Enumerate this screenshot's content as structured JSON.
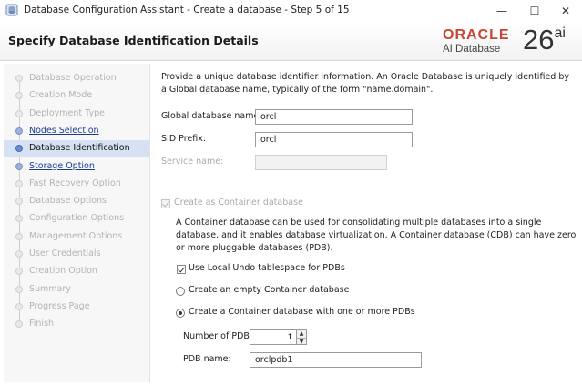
{
  "window": {
    "title": "Database Configuration Assistant - Create a database - Step 5 of 15",
    "controls": {
      "minimize": "—",
      "maximize": "☐",
      "close": "✕"
    }
  },
  "header": {
    "page_title": "Specify Database Identification Details",
    "logo": {
      "brand": "ORACLE",
      "product": "AI Database",
      "version": "26",
      "version_suffix": "ai",
      "brand_color": "#c74634"
    }
  },
  "nav": {
    "items": [
      {
        "label": "Database Operation",
        "state": "disabled"
      },
      {
        "label": "Creation Mode",
        "state": "disabled"
      },
      {
        "label": "Deployment Type",
        "state": "disabled"
      },
      {
        "label": "Nodes Selection",
        "state": "link"
      },
      {
        "label": "Database Identification",
        "state": "current"
      },
      {
        "label": "Storage Option",
        "state": "link"
      },
      {
        "label": "Fast Recovery Option",
        "state": "disabled"
      },
      {
        "label": "Database Options",
        "state": "disabled"
      },
      {
        "label": "Configuration Options",
        "state": "disabled"
      },
      {
        "label": "Management Options",
        "state": "disabled"
      },
      {
        "label": "User Credentials",
        "state": "disabled"
      },
      {
        "label": "Creation Option",
        "state": "disabled"
      },
      {
        "label": "Summary",
        "state": "disabled"
      },
      {
        "label": "Progress Page",
        "state": "disabled"
      },
      {
        "label": "Finish",
        "state": "disabled"
      }
    ]
  },
  "content": {
    "intro": "Provide a unique database identifier information. An Oracle Database is uniquely identified by a Global database name, typically of the form \"name.domain\".",
    "global_db_name": {
      "label": "Global database name:",
      "value": "orcl"
    },
    "sid_prefix": {
      "label": "SID Prefix:",
      "value": "orcl"
    },
    "service_name": {
      "label": "Service name:",
      "value": ""
    },
    "container_db": {
      "label": "Create as Container database",
      "checked": true,
      "enabled": false
    },
    "container_desc": "A Container database can be used for consolidating multiple databases into a single database, and it enables database virtualization. A Container database (CDB) can have zero or more pluggable databases (PDB).",
    "local_undo": {
      "label": "Use Local Undo tablespace for PDBs",
      "checked": true
    },
    "empty_cdb": {
      "label": "Create an empty Container database",
      "selected": false
    },
    "cdb_with_pdbs": {
      "label": "Create a Container database with one or more PDBs",
      "selected": true
    },
    "num_pdbs": {
      "label": "Number of PDBs:",
      "value": "1"
    },
    "pdb_name": {
      "label": "PDB name:",
      "value": "orclpdb1"
    }
  }
}
